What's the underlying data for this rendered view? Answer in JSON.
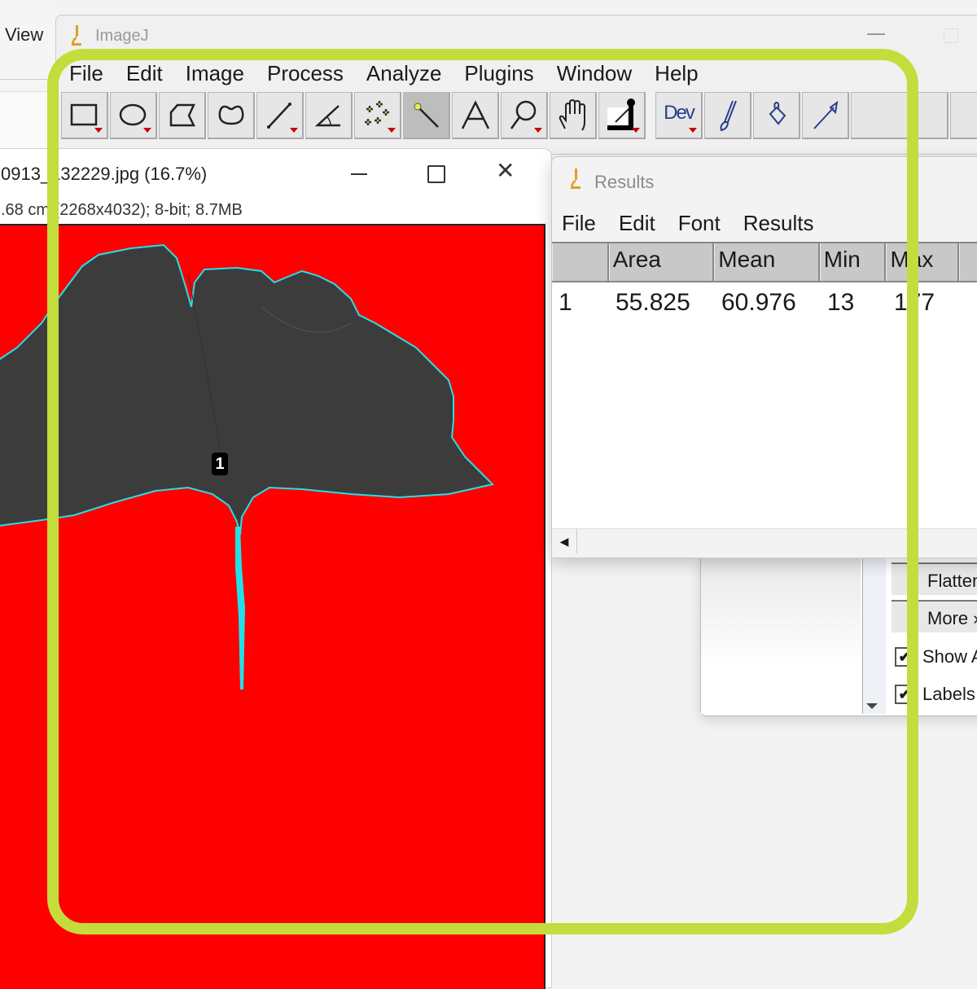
{
  "background": {
    "explorer_menu_label": "View"
  },
  "imagej": {
    "title": "ImageJ",
    "menu": [
      "File",
      "Edit",
      "Image",
      "Process",
      "Analyze",
      "Plugins",
      "Window",
      "Help"
    ],
    "tools": [
      {
        "name": "rectangle-tool",
        "dropdown": true
      },
      {
        "name": "oval-tool",
        "dropdown": true
      },
      {
        "name": "polygon-tool",
        "dropdown": false
      },
      {
        "name": "freehand-tool",
        "dropdown": false
      },
      {
        "name": "line-tool",
        "dropdown": true
      },
      {
        "name": "angle-tool",
        "dropdown": false
      },
      {
        "name": "multipoint-tool",
        "dropdown": true
      },
      {
        "name": "wand-tool",
        "dropdown": false,
        "active": true
      },
      {
        "name": "text-tool",
        "dropdown": false
      },
      {
        "name": "magnifier-tool",
        "dropdown": true
      },
      {
        "name": "scrolling-tool",
        "dropdown": false
      },
      {
        "name": "color-picker-tool",
        "dropdown": true
      },
      {
        "name": "developer-menu",
        "label": "Dev",
        "dropdown": true
      },
      {
        "name": "brush-tool",
        "dropdown": false
      },
      {
        "name": "flood-fill-tool",
        "dropdown": false
      },
      {
        "name": "arrow-tool",
        "dropdown": false
      }
    ]
  },
  "image_window": {
    "title": "0913_132229.jpg (16.7%)",
    "info": ".68 cm (2268x4032); 8-bit; 8.7MB",
    "roi_label": "1",
    "colors": {
      "background": "#ff0000",
      "leaf": "#3c3c3c",
      "outline": "#22e0e8"
    }
  },
  "results_window": {
    "title": "Results",
    "menu": [
      "File",
      "Edit",
      "Font",
      "Results"
    ],
    "columns": [
      "",
      "Area",
      "Mean",
      "Min",
      "Max",
      ""
    ],
    "rows": [
      [
        "1",
        "55.825",
        "60.976",
        "13",
        "177",
        ""
      ]
    ]
  },
  "roi_manager": {
    "buttons": [
      "Flatten",
      "More »"
    ],
    "checkboxes": [
      {
        "label": "Show All",
        "checked": true
      },
      {
        "label": "Labels",
        "checked": true
      }
    ],
    "check_glyph": "✔"
  },
  "annotation": {
    "highlight_color": "#c4dc3c"
  }
}
